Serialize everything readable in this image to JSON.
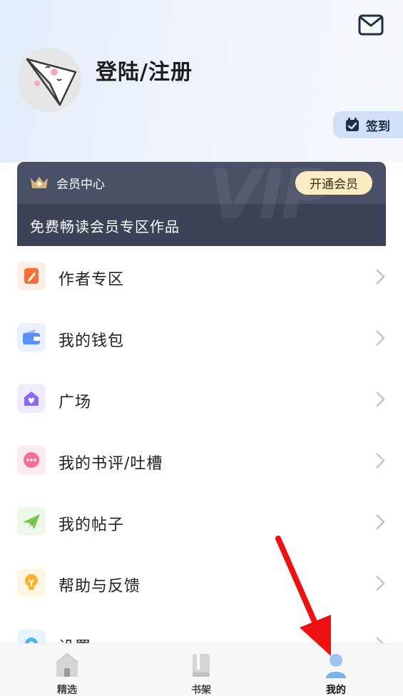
{
  "header": {
    "login_label": "登陆/注册",
    "signin_label": "签到"
  },
  "vip": {
    "title": "会员中心",
    "open_label": "开通会员",
    "subtitle": "免费畅读会员专区作品",
    "watermark": "VIP"
  },
  "menu": {
    "items": [
      {
        "label": "作者专区",
        "icon": "pen-icon",
        "color": "#f5733a"
      },
      {
        "label": "我的钱包",
        "icon": "wallet-icon",
        "color": "#5b8ff9"
      },
      {
        "label": "广场",
        "icon": "house-heart-icon",
        "color": "#8b6cf0"
      },
      {
        "label": "我的书评/吐槽",
        "icon": "chat-bubble-icon",
        "color": "#f0709a"
      },
      {
        "label": "我的帖子",
        "icon": "paper-plane-icon",
        "color": "#7dc855"
      },
      {
        "label": "帮助与反馈",
        "icon": "lightbulb-icon",
        "color": "#f6b530"
      },
      {
        "label": "设置",
        "icon": "gear-icon",
        "color": "#4fb7e8"
      }
    ]
  },
  "tabbar": {
    "tabs": [
      {
        "label": "精选",
        "icon": "home-icon"
      },
      {
        "label": "书架",
        "icon": "book-icon"
      },
      {
        "label": "我的",
        "icon": "profile-icon",
        "active": true
      }
    ]
  },
  "colors": {
    "accent": "#4a7fe0",
    "vip_bg": "#3c4257",
    "vip_button": "#fbecc4",
    "annotation_arrow": "#ee1111"
  }
}
